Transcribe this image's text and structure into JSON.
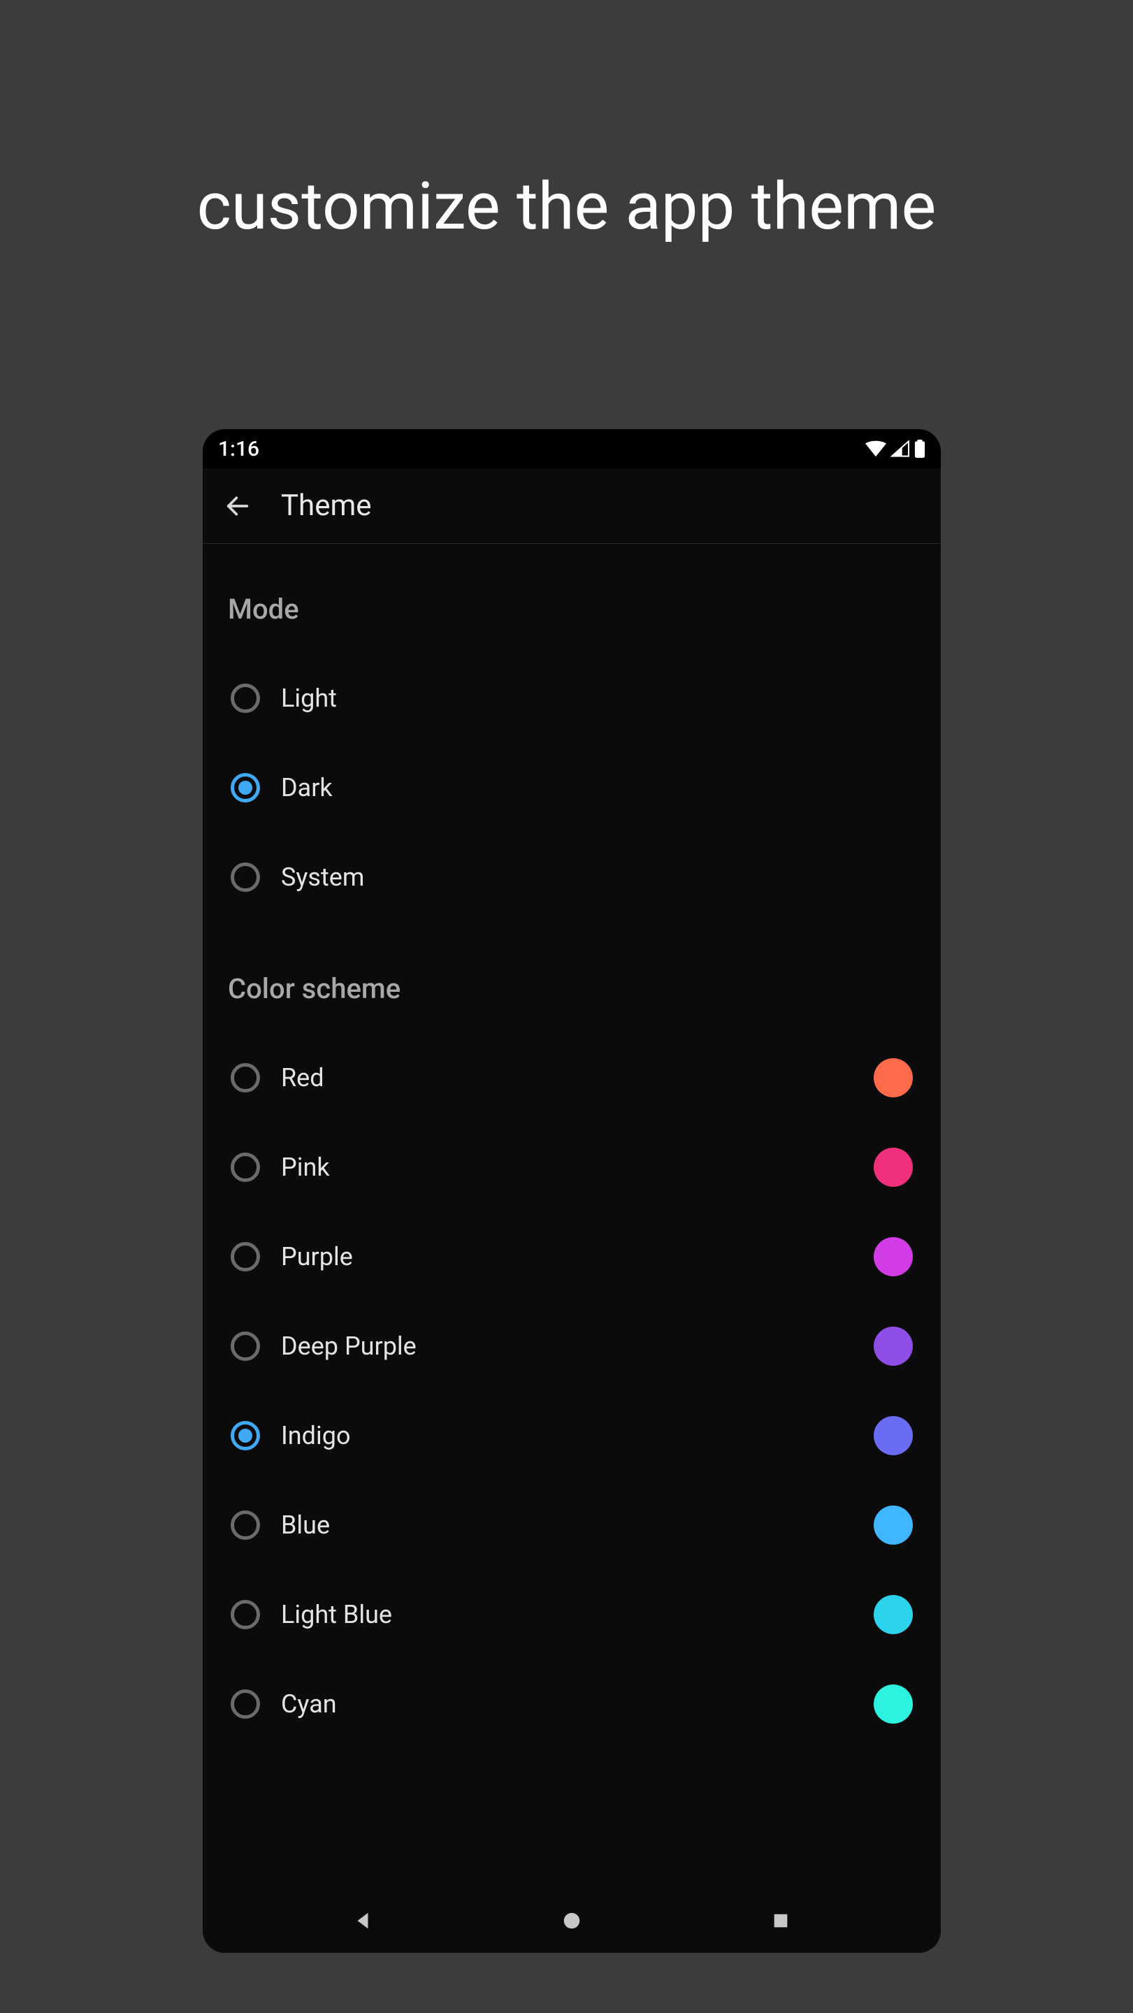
{
  "caption": "customize the app theme",
  "statusBar": {
    "time": "1:16"
  },
  "appBar": {
    "title": "Theme"
  },
  "accentColor": "#3fa9f5",
  "modeSection": {
    "header": "Mode",
    "options": [
      {
        "label": "Light",
        "selected": false
      },
      {
        "label": "Dark",
        "selected": true
      },
      {
        "label": "System",
        "selected": false
      }
    ]
  },
  "colorSection": {
    "header": "Color scheme",
    "options": [
      {
        "label": "Red",
        "selected": false,
        "swatch": "#ff6b4a"
      },
      {
        "label": "Pink",
        "selected": false,
        "swatch": "#f0307d"
      },
      {
        "label": "Purple",
        "selected": false,
        "swatch": "#d13ce6"
      },
      {
        "label": "Deep Purple",
        "selected": false,
        "swatch": "#8e4ee6"
      },
      {
        "label": "Indigo",
        "selected": true,
        "swatch": "#6a6cf2"
      },
      {
        "label": "Blue",
        "selected": false,
        "swatch": "#3fb6ff"
      },
      {
        "label": "Light Blue",
        "selected": false,
        "swatch": "#2bd3ec"
      },
      {
        "label": "Cyan",
        "selected": false,
        "swatch": "#2ef2e0"
      }
    ]
  }
}
